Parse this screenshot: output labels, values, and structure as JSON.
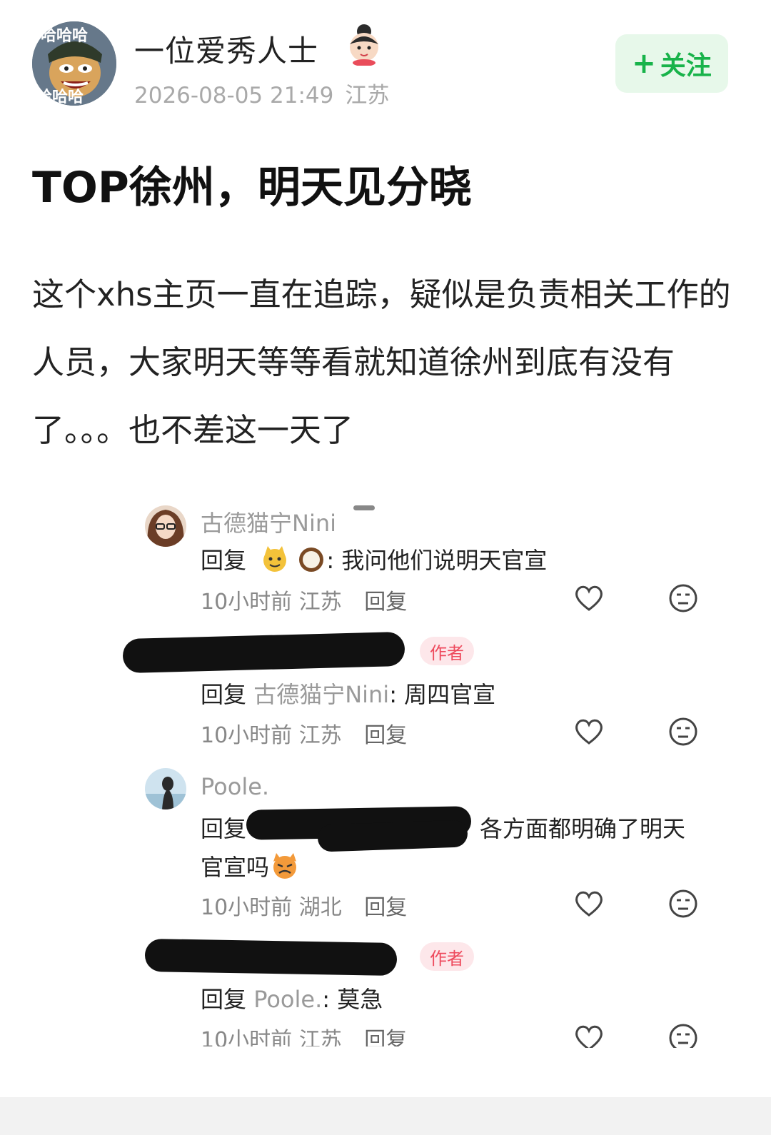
{
  "post": {
    "author": "一位爱秀人士",
    "time": "2026-08-05 21:49",
    "location": "江苏",
    "follow_plus": "+",
    "follow_label": "关注",
    "title": "TOP徐州，明天见分晓",
    "body": "这个xhs主页一直在追踪，疑似是负责相关工作的人员，大家明天等等看就知道徐州到底有没有了。。。也不差这一天了"
  },
  "avatar_text": [
    "哈哈哈",
    "哈哈哈"
  ],
  "comments": [
    {
      "name": "古德猫宁Nini",
      "reply_prefix": "回复",
      "target": "",
      "sep": ":",
      "text": "我问他们说明天官宣",
      "time": "10小时前",
      "location": "江苏",
      "reply": "回复"
    },
    {
      "name": "",
      "tag": "作者",
      "reply_prefix": "回复",
      "target": "古德猫宁Nini",
      "sep": ":",
      "text": "周四官宣",
      "time": "10小时前",
      "location": "江苏",
      "reply": "回复"
    },
    {
      "name": "Poole.",
      "reply_prefix": "回复",
      "target": "",
      "sep": "",
      "text": "各方面都明确了明天",
      "text2": "官宣吗",
      "time": "10小时前",
      "location": "湖北",
      "reply": "回复"
    },
    {
      "name": "",
      "tag": "作者",
      "reply_prefix": "回复",
      "target": "Poole.",
      "sep": ":",
      "text": "莫急",
      "time": "10小时前",
      "location": "江苏",
      "reply": "回复"
    }
  ]
}
